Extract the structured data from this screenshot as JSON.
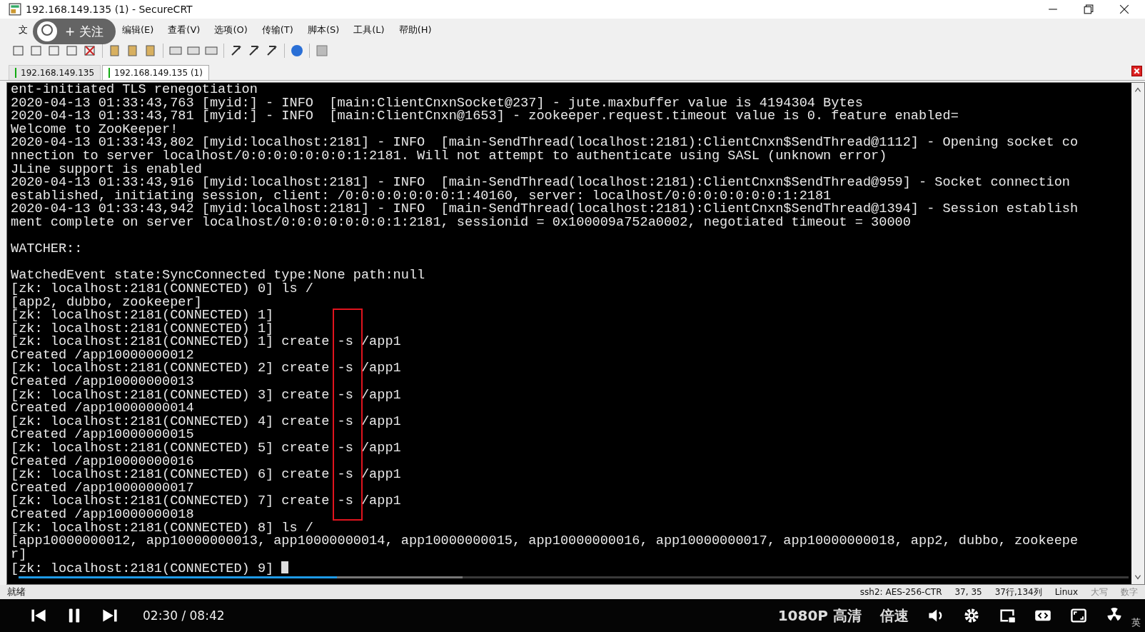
{
  "window": {
    "title": "192.168.149.135 (1) - SecureCRT"
  },
  "menu": [
    "文",
    "编辑(E)",
    "查看(V)",
    "选项(O)",
    "传输(T)",
    "脚本(S)",
    "工具(L)",
    "帮助(H)"
  ],
  "follow_overlay": {
    "label": "+ 关注"
  },
  "tabs": [
    {
      "label": "192.168.149.135",
      "selected": false,
      "connected": true
    },
    {
      "label": "192.168.149.135 (1)",
      "selected": true,
      "connected": true
    }
  ],
  "terminal": {
    "lines": [
      {
        "kind": "text",
        "text": "ent-initiated TLS renegotiation"
      },
      {
        "kind": "text",
        "text": "2020-04-13 01:33:43,763 [myid:] - INFO  [main:ClientCnxnSocket@237] - jute.maxbuffer value is 4194304 Bytes"
      },
      {
        "kind": "text",
        "text": "2020-04-13 01:33:43,781 [myid:] - INFO  [main:ClientCnxn@1653] - zookeeper.request.timeout value is 0. feature enabled="
      },
      {
        "kind": "text",
        "text": "Welcome to ZooKeeper!"
      },
      {
        "kind": "text",
        "text": "2020-04-13 01:33:43,802 [myid:localhost:2181] - INFO  [main-SendThread(localhost:2181):ClientCnxn$SendThread@1112] - Opening socket co"
      },
      {
        "kind": "text",
        "text": "nnection to server localhost/0:0:0:0:0:0:0:1:2181. Will not attempt to authenticate using SASL (unknown error)"
      },
      {
        "kind": "text",
        "text": "JLine support is enabled"
      },
      {
        "kind": "text",
        "text": "2020-04-13 01:33:43,916 [myid:localhost:2181] - INFO  [main-SendThread(localhost:2181):ClientCnxn$SendThread@959] - Socket connection"
      },
      {
        "kind": "text",
        "text": "established, initiating session, client: /0:0:0:0:0:0:0:1:40160, server: localhost/0:0:0:0:0:0:0:1:2181"
      },
      {
        "kind": "text",
        "text": "2020-04-13 01:33:43,942 [myid:localhost:2181] - INFO  [main-SendThread(localhost:2181):ClientCnxn$SendThread@1394] - Session establish"
      },
      {
        "kind": "text",
        "text": "ment complete on server localhost/0:0:0:0:0:0:0:1:2181, sessionid = 0x100009a752a0002, negotiated timeout = 30000"
      },
      {
        "kind": "blank"
      },
      {
        "kind": "text",
        "text": "WATCHER::"
      },
      {
        "kind": "blank"
      },
      {
        "kind": "text",
        "text": "WatchedEvent state:SyncConnected type:None path:null"
      },
      {
        "kind": "text",
        "text": "[zk: localhost:2181(CONNECTED) 0] ls /"
      },
      {
        "kind": "text",
        "text": "[app2, dubbo, zookeeper]"
      },
      {
        "kind": "text",
        "text": "[zk: localhost:2181(CONNECTED) 1]"
      },
      {
        "kind": "text",
        "text": "[zk: localhost:2181(CONNECTED) 1]"
      },
      {
        "kind": "text",
        "text": "[zk: localhost:2181(CONNECTED) 1] create -s /app1"
      },
      {
        "kind": "text",
        "text": "Created /app10000000012"
      },
      {
        "kind": "text",
        "text": "[zk: localhost:2181(CONNECTED) 2] create -s /app1"
      },
      {
        "kind": "text",
        "text": "Created /app10000000013"
      },
      {
        "kind": "text",
        "text": "[zk: localhost:2181(CONNECTED) 3] create -s /app1"
      },
      {
        "kind": "text",
        "text": "Created /app10000000014"
      },
      {
        "kind": "text",
        "text": "[zk: localhost:2181(CONNECTED) 4] create -s /app1"
      },
      {
        "kind": "text",
        "text": "Created /app10000000015"
      },
      {
        "kind": "text",
        "text": "[zk: localhost:2181(CONNECTED) 5] create -s /app1"
      },
      {
        "kind": "text",
        "text": "Created /app10000000016"
      },
      {
        "kind": "text",
        "text": "[zk: localhost:2181(CONNECTED) 6] create -s /app1"
      },
      {
        "kind": "text",
        "text": "Created /app10000000017"
      },
      {
        "kind": "text",
        "text": "[zk: localhost:2181(CONNECTED) 7] create -s /app1"
      },
      {
        "kind": "text",
        "text": "Created /app10000000018"
      },
      {
        "kind": "text",
        "text": "[zk: localhost:2181(CONNECTED) 8] ls /"
      },
      {
        "kind": "text",
        "text": "[app10000000012, app10000000013, app10000000014, app10000000015, app10000000016, app10000000017, app10000000018, app2, dubbo, zookeepe"
      },
      {
        "kind": "text",
        "text": "r]"
      },
      {
        "kind": "prompt",
        "text": "[zk: localhost:2181(CONNECTED) 9]",
        "cursor": true
      }
    ]
  },
  "status_bar": {
    "ready": "就绪",
    "cipher": "ssh2: AES-256-CTR",
    "position": "37,  35",
    "size": "37行,134列",
    "os": "Linux",
    "caps": {
      "label": "大写",
      "on": false
    },
    "num": {
      "label": "数字",
      "on": false
    }
  },
  "player": {
    "level": 0.287,
    "time": "02:30 / 08:42",
    "quality": "1080P 高清",
    "speed": "倍速",
    "paused": false
  },
  "taskbar": {
    "ime": "英"
  }
}
